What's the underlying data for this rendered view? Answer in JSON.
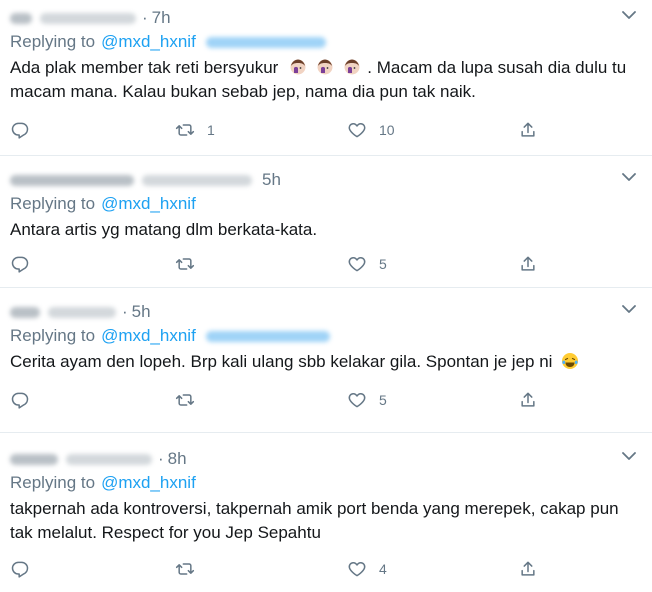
{
  "colors": {
    "link": "#1da1f2",
    "muted": "#657786",
    "text": "#14171a",
    "divider": "#e6ecf0"
  },
  "tweets": [
    {
      "time": "7h",
      "replying_label": "Replying to",
      "mention": "@mxd_hxnif",
      "text_a": "Ada plak member tak reti bersyukur",
      "text_b": ". Macam da lupa susah dia dulu tu macam mana. Kalau bukan sebab jep, nama dia pun tak naik.",
      "emoji": "face-palm-emoji",
      "retweets": "1",
      "likes": "10"
    },
    {
      "time": "5h",
      "replying_label": "Replying to",
      "mention": "@mxd_hxnif",
      "text": "Antara artis yg matang dlm berkata-kata.",
      "retweets": "",
      "likes": "5"
    },
    {
      "time": "5h",
      "replying_label": "Replying to",
      "mention": "@mxd_hxnif",
      "text": "Cerita ayam den lopeh. Brp kali ulang sbb kelakar gila. Spontan je jep ni",
      "emoji": "tears-of-joy-emoji",
      "retweets": "",
      "likes": "5"
    },
    {
      "time": "8h",
      "replying_label": "Replying to",
      "mention": "@mxd_hxnif",
      "text": "takpernah ada kontroversi, takpernah amik port benda yang merepek, cakap pun tak melalut. Respect for you Jep Sepahtu",
      "retweets": "",
      "likes": "4"
    }
  ],
  "icons": {
    "reply": "reply-icon",
    "retweet": "retweet-icon",
    "like": "like-icon",
    "share": "share-icon",
    "more": "chevron-down-icon"
  }
}
